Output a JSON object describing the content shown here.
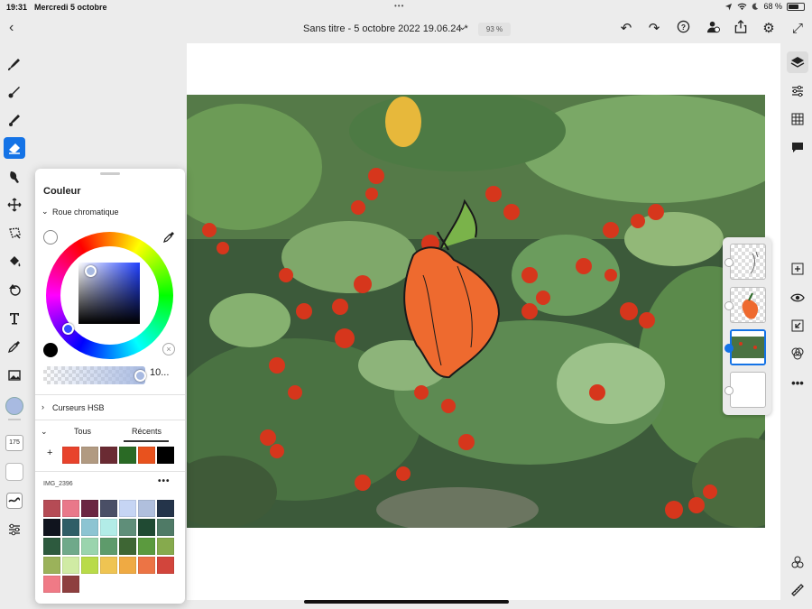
{
  "status_bar": {
    "time": "19:31",
    "date": "Mercredi 5 octobre",
    "battery": "68 %",
    "battery_level": 0.68
  },
  "toolbar": {
    "title": "Sans titre - 5 octobre 2022 19.06.24 *",
    "zoom": "93 %"
  },
  "color_panel": {
    "title": "Couleur",
    "wheel_section": "Roue chromatique",
    "opacity_value": "10...",
    "hsb_section": "Curseurs HSB",
    "tabs": [
      "Tous",
      "Récents"
    ],
    "active_tab": "Récents",
    "current_color": "#a8bae1",
    "recent_swatches": [
      "#e8432c",
      "#b19a81",
      "#6a2b33",
      "#2a6a25",
      "#e8521e",
      "#000000"
    ],
    "gallery_name": "IMG_2396",
    "gallery_swatches": [
      "#b54b55",
      "#e9788a",
      "#6b2642",
      "#4a4f66",
      "#c6d5f4",
      "#b0bfdd",
      "#24344a",
      "#10141e",
      "#2f5e67",
      "#8cc4d2",
      "#b2ece7",
      "#5f8e79",
      "#204a33",
      "#4f7a66",
      "#2d5a3e",
      "#6fa98a",
      "#9ad4ad",
      "#5e9b6b",
      "#3e6634",
      "#5b9a3e",
      "#86aa4d",
      "#9bb25a",
      "#d0eba4",
      "#b9db49",
      "#efc452",
      "#efaa43",
      "#ec7445",
      "#d2453c",
      "#f07a86",
      "#8e3f3f"
    ]
  },
  "tools": {
    "brush_size": "175"
  }
}
